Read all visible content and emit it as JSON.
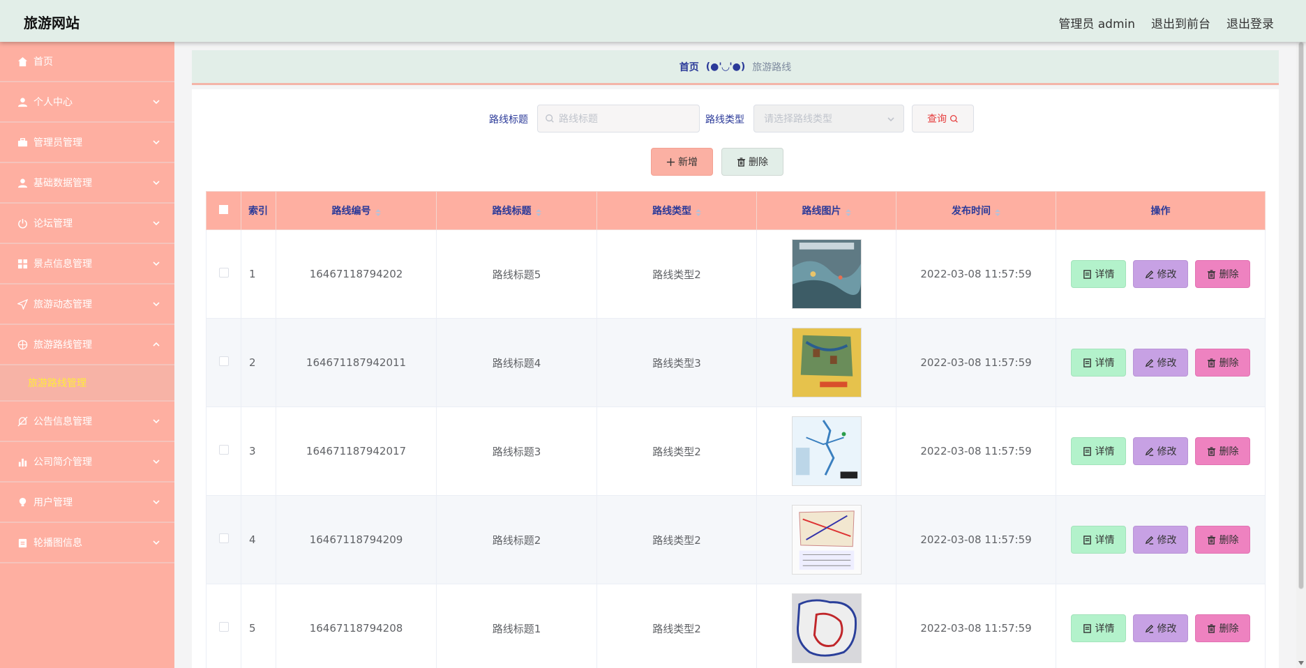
{
  "header": {
    "brand": "旅游网站",
    "admin_label": "管理员 admin",
    "to_front": "退出到前台",
    "logout": "退出登录"
  },
  "sidebar": {
    "items": [
      {
        "label": "首页",
        "icon": "home-icon",
        "has_chevron": false
      },
      {
        "label": "个人中心",
        "icon": "user-icon",
        "has_chevron": true
      },
      {
        "label": "管理员管理",
        "icon": "briefcase-icon",
        "has_chevron": true
      },
      {
        "label": "基础数据管理",
        "icon": "user-icon",
        "has_chevron": true
      },
      {
        "label": "论坛管理",
        "icon": "power-icon",
        "has_chevron": true
      },
      {
        "label": "景点信息管理",
        "icon": "grid-icon",
        "has_chevron": true
      },
      {
        "label": "旅游动态管理",
        "icon": "send-icon",
        "has_chevron": true
      },
      {
        "label": "旅游路线管理",
        "icon": "compass-icon",
        "has_chevron": true,
        "expanded": true
      },
      {
        "label": "公告信息管理",
        "icon": "bell-off-icon",
        "has_chevron": true
      },
      {
        "label": "公司简介管理",
        "icon": "bar-chart-icon",
        "has_chevron": true
      },
      {
        "label": "用户管理",
        "icon": "bulb-icon",
        "has_chevron": true
      },
      {
        "label": "轮播图信息",
        "icon": "clipboard-icon",
        "has_chevron": true
      }
    ],
    "sub_item": "旅游路线管理"
  },
  "breadcrumb": {
    "home": "首页",
    "face": "(●'◡'●)",
    "current": "旅游路线"
  },
  "search": {
    "title_label": "路线标题",
    "title_placeholder": "路线标题",
    "type_label": "路线类型",
    "type_placeholder": "请选择路线类型",
    "query_button": "查询"
  },
  "actions": {
    "add": "新增",
    "delete": "删除"
  },
  "table": {
    "headers": {
      "index": "索引",
      "code": "路线编号",
      "title": "路线标题",
      "type": "路线类型",
      "image": "路线图片",
      "time": "发布时间",
      "ops": "操作"
    },
    "op_labels": {
      "detail": "详情",
      "edit": "修改",
      "delete": "删除"
    },
    "rows": [
      {
        "index": "1",
        "code": "16467118794202",
        "title": "路线标题5",
        "type": "路线类型2",
        "time": "2022-03-08 11:57:59"
      },
      {
        "index": "2",
        "code": "164671187942011",
        "title": "路线标题4",
        "type": "路线类型3",
        "time": "2022-03-08 11:57:59"
      },
      {
        "index": "3",
        "code": "164671187942017",
        "title": "路线标题3",
        "type": "路线类型2",
        "time": "2022-03-08 11:57:59"
      },
      {
        "index": "4",
        "code": "16467118794209",
        "title": "路线标题2",
        "type": "路线类型2",
        "time": "2022-03-08 11:57:59"
      },
      {
        "index": "5",
        "code": "16467118794208",
        "title": "路线标题1",
        "type": "路线类型2",
        "time": "2022-03-08 11:57:59"
      }
    ]
  },
  "colors": {
    "sidebar_bg": "#feafa1",
    "header_bg": "#e2eee8",
    "accent_text": "#2b3a99",
    "detail_btn": "#b3f2cb",
    "edit_btn": "#c7a1e4",
    "delete_btn": "#ee82c0"
  }
}
